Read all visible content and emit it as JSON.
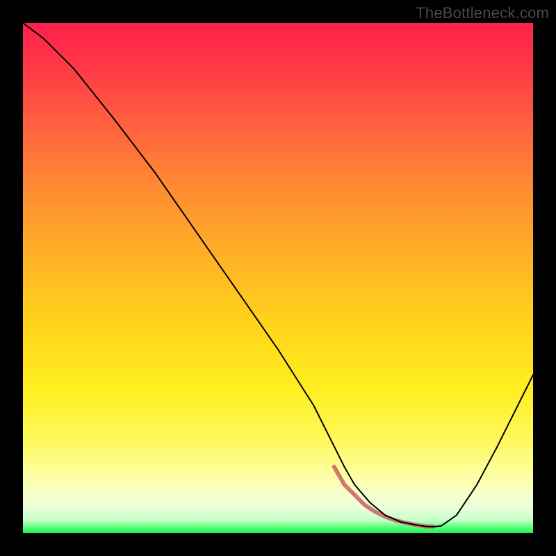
{
  "watermark": "TheBottleneck.com",
  "chart_data": {
    "type": "line",
    "title": "",
    "xlabel": "",
    "ylabel": "",
    "xlim": [
      0,
      100
    ],
    "ylim": [
      0,
      100
    ],
    "series": [
      {
        "name": "bottleneck-curve",
        "x": [
          0,
          4,
          10,
          18,
          26,
          34,
          42,
          50,
          57,
          61,
          63,
          65,
          68,
          71,
          74,
          77,
          79,
          80.5,
          82,
          85,
          89,
          93,
          97,
          100
        ],
        "y": [
          100,
          97,
          91,
          81,
          70.5,
          59,
          47.5,
          36,
          25,
          17,
          13,
          9.5,
          6,
          3.5,
          2.2,
          1.6,
          1.3,
          1.25,
          1.4,
          3.5,
          9.5,
          17,
          25,
          31
        ]
      },
      {
        "name": "optimal-band",
        "x": [
          61,
          63,
          65,
          67,
          69,
          71,
          73,
          75,
          77,
          79,
          80.5
        ],
        "y": [
          13,
          9.5,
          7.5,
          5.5,
          4.2,
          3.2,
          2.5,
          2.0,
          1.6,
          1.3,
          1.25
        ]
      }
    ],
    "colors": {
      "curve": "#000000",
      "band": "#cf6a6a"
    }
  }
}
